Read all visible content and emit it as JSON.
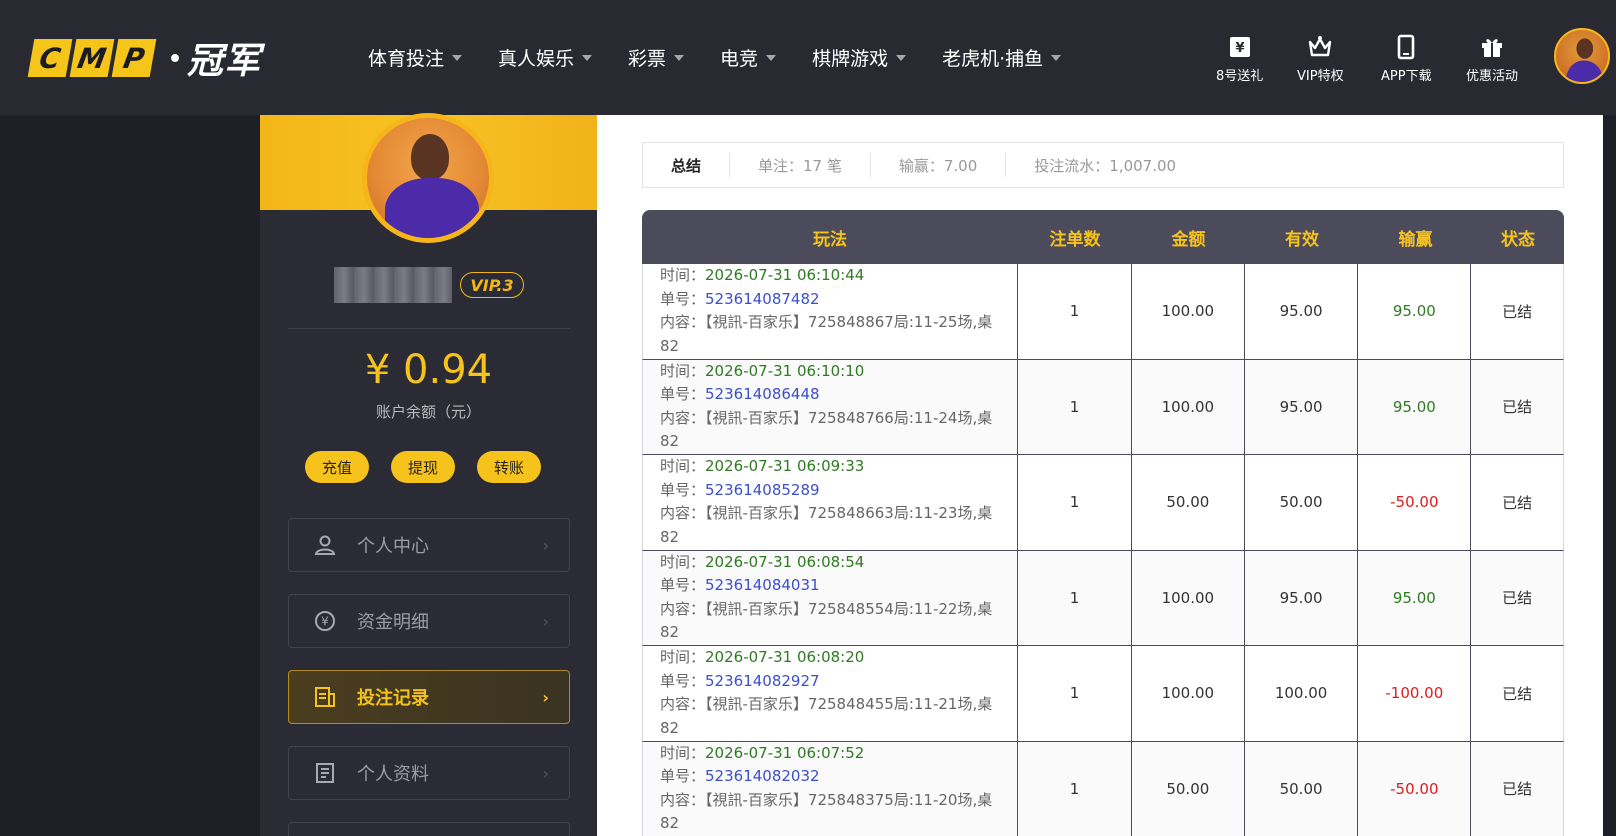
{
  "header": {
    "logo": {
      "letters": [
        "C",
        "M",
        "P"
      ],
      "cn": "冠军"
    },
    "nav": [
      {
        "label": "体育投注"
      },
      {
        "label": "真人娱乐"
      },
      {
        "label": "彩票"
      },
      {
        "label": "电竞"
      },
      {
        "label": "棋牌游戏"
      },
      {
        "label": "老虎机·捕鱼"
      }
    ],
    "quick_links": [
      {
        "label": "8号送礼",
        "icon": "gift-ticket-icon"
      },
      {
        "label": "VIP特权",
        "icon": "crown-icon"
      },
      {
        "label": "APP下载",
        "icon": "phone-icon"
      },
      {
        "label": "优惠活动",
        "icon": "gift-box-icon"
      }
    ]
  },
  "sidebar": {
    "vip": "VIP.3",
    "balance": "¥ 0.94",
    "balance_label": "账户余额（元）",
    "actions": [
      "充值",
      "提现",
      "转账"
    ],
    "menu": [
      {
        "label": "个人中心",
        "icon": "user-icon",
        "active": false
      },
      {
        "label": "资金明细",
        "icon": "yen-cycle-icon",
        "active": false
      },
      {
        "label": "投注记录",
        "icon": "document-list-icon",
        "active": true
      },
      {
        "label": "个人资料",
        "icon": "profile-doc-icon",
        "active": false
      }
    ]
  },
  "summary": {
    "title": "总结",
    "bets": "单注：17 笔",
    "winloss": "输赢：7.00",
    "turnover": "投注流水：1,007.00"
  },
  "table": {
    "headers": [
      "玩法",
      "注单数",
      "金额",
      "有效",
      "输赢",
      "状态"
    ],
    "time_label": "时间：",
    "order_label": "单号：",
    "content_label": "内容：",
    "rows": [
      {
        "time": "2026-07-31 06:10:44",
        "order": "523614087482",
        "content": "【視訊-百家乐】725848867局:11-25场,桌",
        "content2": "82",
        "count": "1",
        "amount": "100.00",
        "valid": "95.00",
        "winloss": "95.00",
        "result": "win",
        "status": "已结"
      },
      {
        "time": "2026-07-31 06:10:10",
        "order": "523614086448",
        "content": "【視訊-百家乐】725848766局:11-24场,桌",
        "content2": "82",
        "count": "1",
        "amount": "100.00",
        "valid": "95.00",
        "winloss": "95.00",
        "result": "win",
        "status": "已结"
      },
      {
        "time": "2026-07-31 06:09:33",
        "order": "523614085289",
        "content": "【視訊-百家乐】725848663局:11-23场,桌",
        "content2": "82",
        "count": "1",
        "amount": "50.00",
        "valid": "50.00",
        "winloss": "-50.00",
        "result": "lose",
        "status": "已结"
      },
      {
        "time": "2026-07-31 06:08:54",
        "order": "523614084031",
        "content": "【視訊-百家乐】725848554局:11-22场,桌",
        "content2": "82",
        "count": "1",
        "amount": "100.00",
        "valid": "95.00",
        "winloss": "95.00",
        "result": "win",
        "status": "已结"
      },
      {
        "time": "2026-07-31 06:08:20",
        "order": "523614082927",
        "content": "【視訊-百家乐】725848455局:11-21场,桌",
        "content2": "82",
        "count": "1",
        "amount": "100.00",
        "valid": "100.00",
        "winloss": "-100.00",
        "result": "lose",
        "status": "已结"
      },
      {
        "time": "2026-07-31 06:07:52",
        "order": "523614082032",
        "content": "【視訊-百家乐】725848375局:11-20场,桌",
        "content2": "82",
        "count": "1",
        "amount": "50.00",
        "valid": "50.00",
        "winloss": "-50.00",
        "result": "lose",
        "status": "已结"
      }
    ]
  },
  "colors": {
    "accent": "#f6c21c",
    "win": "#2f7a23",
    "lose": "#e11b1b",
    "order_link": "#3a4fce",
    "header_bg": "#292932"
  }
}
